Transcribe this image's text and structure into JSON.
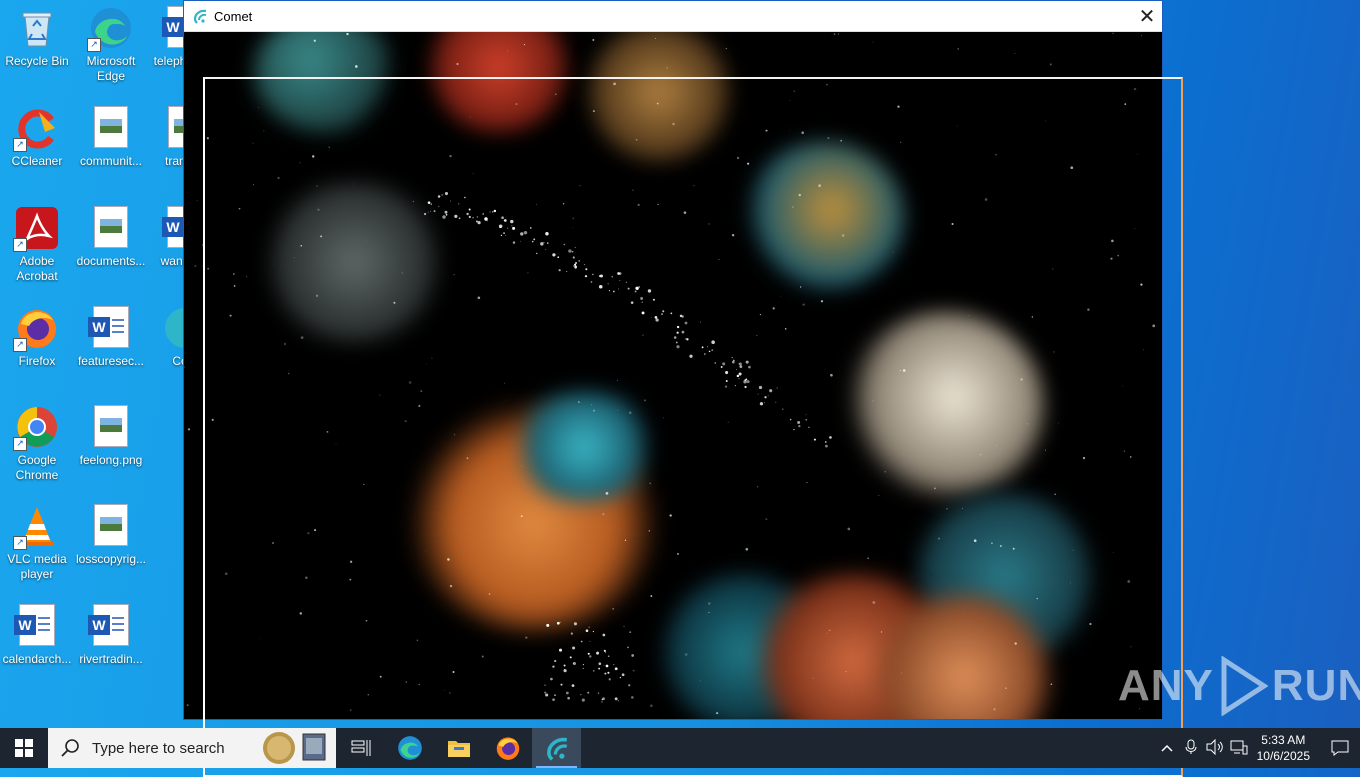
{
  "desktop": {
    "icons": [
      {
        "label": "Recycle Bin",
        "icon": "recycle-bin-icon"
      },
      {
        "label": "Microsoft Edge",
        "icon": "edge-icon"
      },
      {
        "label": "telephone...",
        "icon": "word-doc-icon"
      },
      {
        "label": "CCleaner",
        "icon": "ccleaner-icon"
      },
      {
        "label": "communit...",
        "icon": "image-file-icon"
      },
      {
        "label": "transf...",
        "icon": "image-file-icon"
      },
      {
        "label": "Adobe Acrobat",
        "icon": "acrobat-icon"
      },
      {
        "label": "documents...",
        "icon": "image-file-icon"
      },
      {
        "label": "wanted...",
        "icon": "word-doc-icon"
      },
      {
        "label": "Firefox",
        "icon": "firefox-icon"
      },
      {
        "label": "featuresec...",
        "icon": "word-doc-icon"
      },
      {
        "label": "Co...",
        "icon": "edge-icon"
      },
      {
        "label": "Google Chrome",
        "icon": "chrome-icon"
      },
      {
        "label": "feelong.png",
        "icon": "image-file-icon"
      },
      {
        "label": "VLC media player",
        "icon": "vlc-icon"
      },
      {
        "label": "losscopyrig...",
        "icon": "image-file-icon"
      },
      {
        "label": "calendarch...",
        "icon": "word-doc-icon"
      },
      {
        "label": "rivertradin...",
        "icon": "word-doc-icon"
      }
    ]
  },
  "window": {
    "title": "Comet",
    "close_glyph": "✕"
  },
  "watermark": {
    "text_left": "ANY",
    "text_right": "RUN"
  },
  "taskbar": {
    "search_placeholder": "Type here to search",
    "pinned": [
      "task-view-icon",
      "edge-icon",
      "file-explorer-icon",
      "firefox-icon",
      "comet-icon"
    ],
    "active": "comet-icon",
    "clock_time": "5:33 AM",
    "clock_date": "10/6/2025"
  },
  "colors": {
    "desktop_bg": "#1790e0",
    "taskbar_bg": "#1c2530",
    "window_border": "#1a5fc0",
    "comet_accent": "#2fb5c9"
  }
}
